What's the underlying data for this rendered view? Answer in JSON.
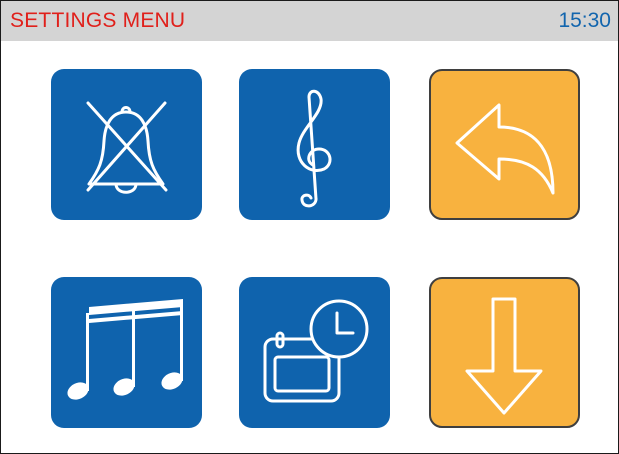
{
  "header": {
    "title": "SETTINGS MENU",
    "time": "15:30"
  },
  "colors": {
    "title_text": "#e0201b",
    "time_text": "#1265ae",
    "header_bg": "#d4d4d4",
    "tile_blue": "#0f63ad",
    "tile_orange": "#f8b23f",
    "icon_stroke": "#ffffff"
  },
  "tiles": [
    {
      "icon": "bell-muted-icon",
      "color": "blue"
    },
    {
      "icon": "treble-clef-icon",
      "color": "blue"
    },
    {
      "icon": "back-arrow-icon",
      "color": "orange"
    },
    {
      "icon": "music-notes-icon",
      "color": "blue"
    },
    {
      "icon": "calendar-clock-icon",
      "color": "blue"
    },
    {
      "icon": "down-arrow-icon",
      "color": "orange"
    }
  ]
}
